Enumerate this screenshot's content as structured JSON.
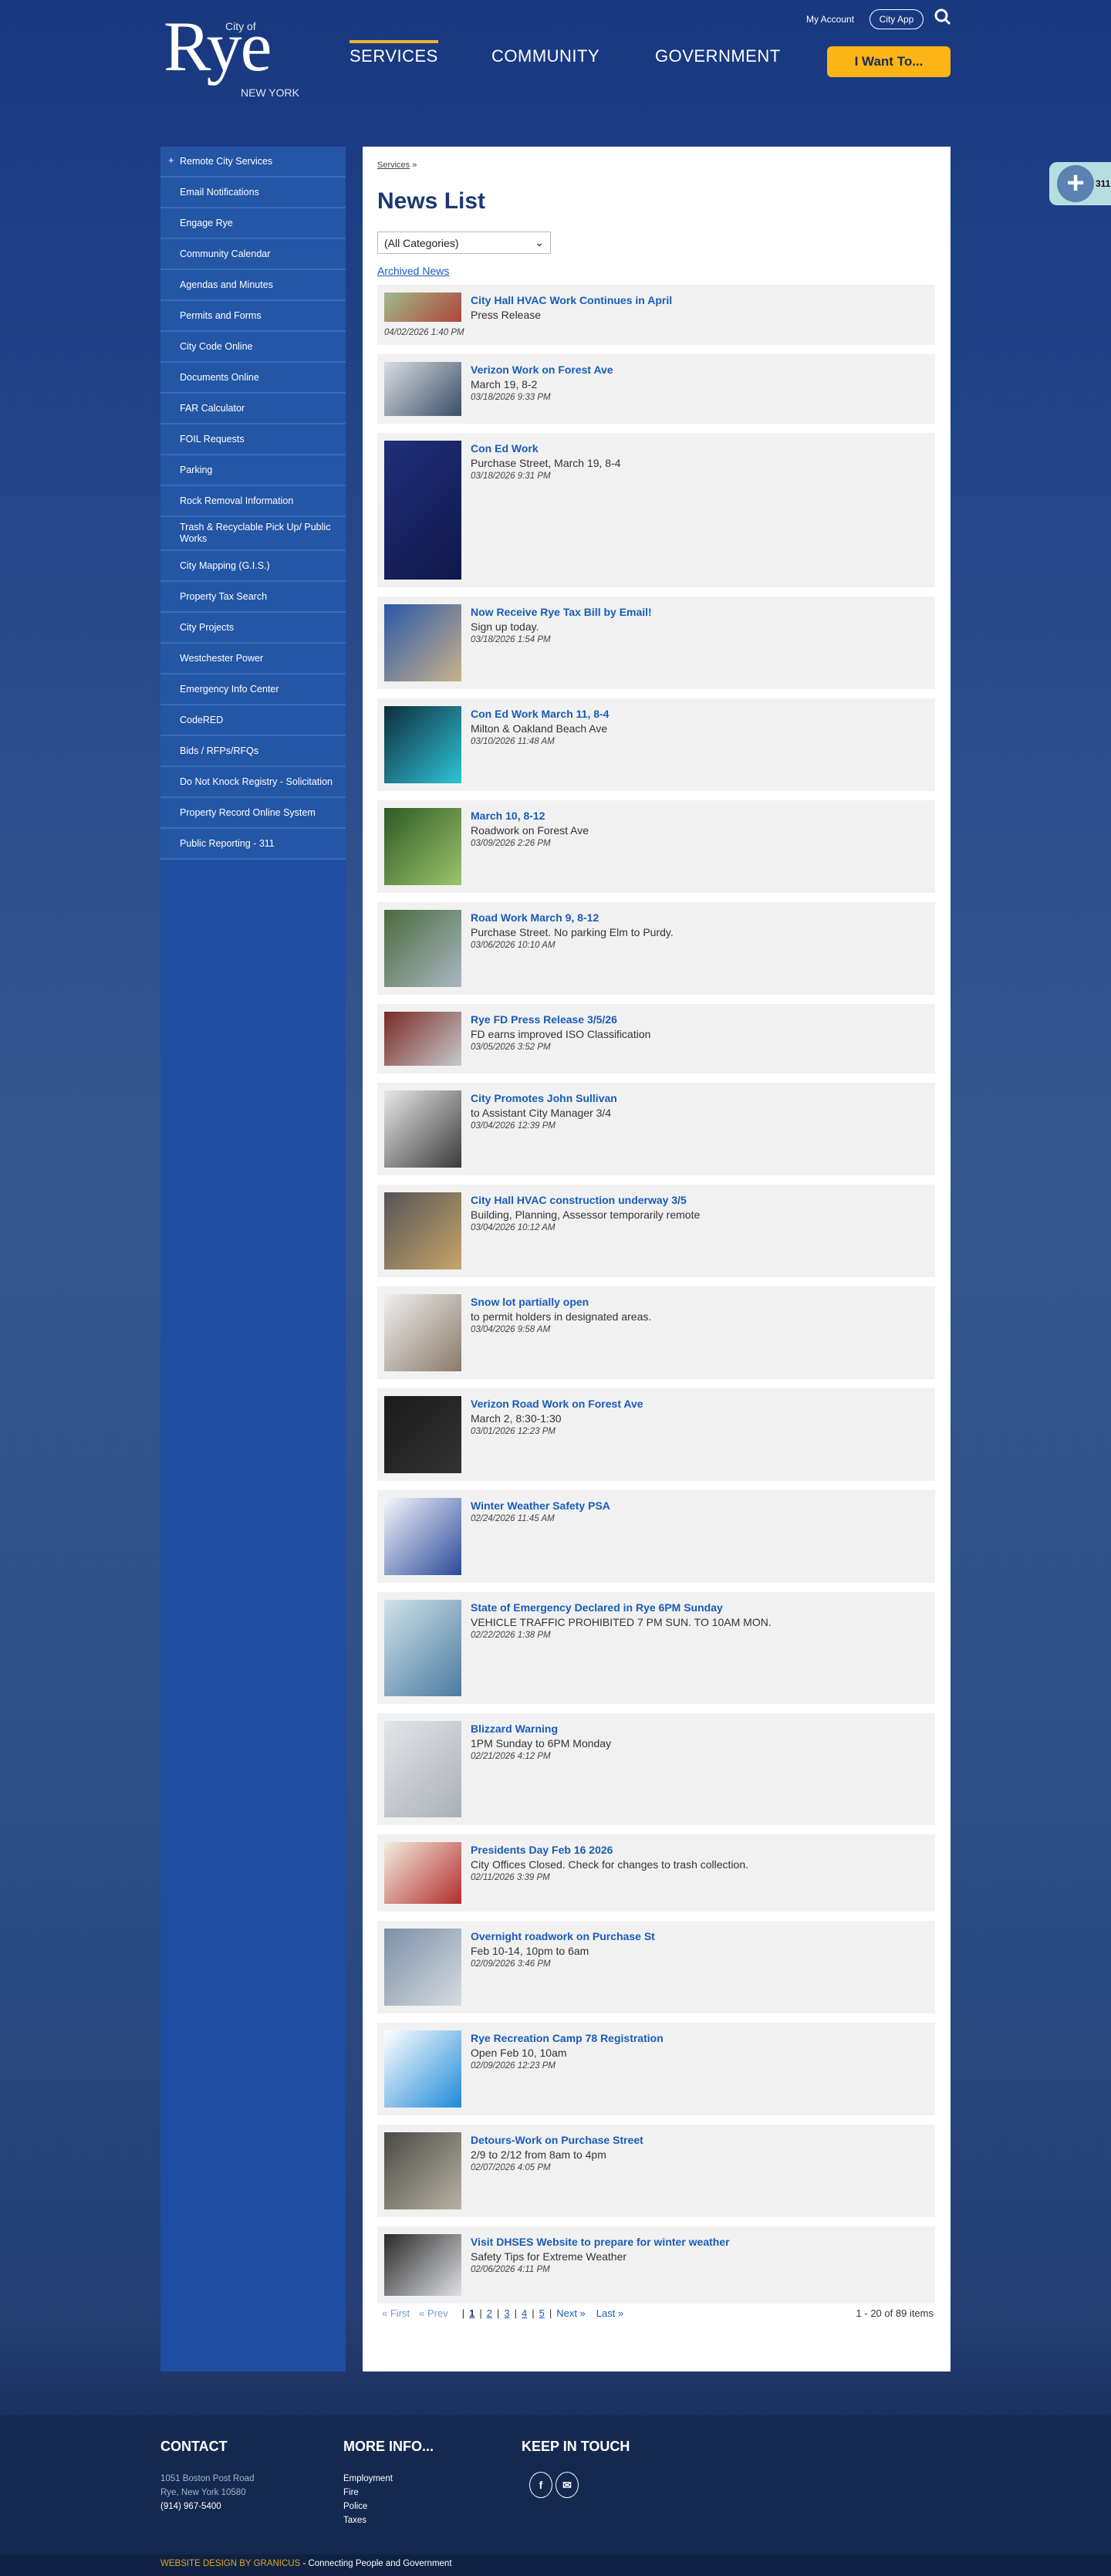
{
  "header": {
    "logo": {
      "city_of": "City of",
      "name": "Rye",
      "state": "NEW YORK"
    },
    "my_account": "My Account",
    "city_app": "City App",
    "nav": [
      "SERVICES",
      "COMMUNITY",
      "GOVERNMENT"
    ],
    "i_want_to": "I Want To..."
  },
  "sidebar": {
    "items": [
      "Remote City Services",
      "Email Notifications",
      "Engage Rye",
      "Community Calendar",
      "Agendas and Minutes",
      "Permits and Forms",
      "City Code Online",
      "Documents Online",
      "FAR Calculator",
      "FOIL Requests",
      "Parking",
      "Rock Removal Information",
      "Trash & Recyclable Pick Up/ Public Works",
      "City Mapping (G.I.S.)",
      "Property Tax Search",
      "City Projects",
      "Westchester Power",
      "Emergency Info Center",
      "CodeRED",
      "Bids / RFPs/RFQs",
      "Do Not Knock Registry - Solicitation",
      "Property Record Online System",
      "Public Reporting - 311"
    ]
  },
  "main": {
    "breadcrumb": "Services",
    "breadcrumb_sep": "»",
    "title": "News List",
    "category_select": "(All Categories)",
    "archived_link": "Archived News",
    "news": [
      {
        "title": "City Hall HVAC Work Continues in April",
        "sub": "Press Release",
        "date": "04/02/2026 1:40 PM"
      },
      {
        "title": "Verizon Work on Forest Ave",
        "sub": "March 19, 8-2",
        "date": "03/18/2026 9:33 PM"
      },
      {
        "title": "Con Ed Work",
        "sub": "Purchase Street, March 19, 8-4",
        "date": "03/18/2026 9:31 PM"
      },
      {
        "title": "Now Receive Rye Tax Bill by Email!",
        "sub": "Sign up today.",
        "date": "03/18/2026 1:54 PM"
      },
      {
        "title": "Con Ed Work March 11, 8-4",
        "sub": "Milton & Oakland Beach Ave",
        "date": "03/10/2026 11:48 AM"
      },
      {
        "title": "March 10, 8-12",
        "sub": "Roadwork on Forest Ave",
        "date": "03/09/2026 2:26 PM"
      },
      {
        "title": "Road Work March 9, 8-12",
        "sub": "Purchase Street. No parking Elm to Purdy.",
        "date": "03/06/2026 10:10 AM"
      },
      {
        "title": "Rye FD Press Release 3/5/26",
        "sub": "FD earns improved ISO Classification",
        "date": "03/05/2026 3:52 PM"
      },
      {
        "title": "City Promotes John Sullivan",
        "sub": "to Assistant City Manager 3/4",
        "date": "03/04/2026 12:39 PM"
      },
      {
        "title": "City Hall HVAC construction underway 3/5",
        "sub": "Building, Planning, Assessor temporarily remote",
        "date": "03/04/2026 10:12 AM"
      },
      {
        "title": "Snow lot partially open",
        "sub": "to permit holders in designated areas.",
        "date": "03/04/2026 9:58 AM"
      },
      {
        "title": "Verizon Road Work on Forest Ave",
        "sub": "March 2, 8:30-1:30",
        "date": "03/01/2026 12:23 PM"
      },
      {
        "title": "Winter Weather Safety PSA",
        "sub": "",
        "date": "02/24/2026 11:45 AM"
      },
      {
        "title": "State of Emergency Declared in Rye 6PM Sunday",
        "sub": "VEHICLE TRAFFIC PROHIBITED 7 PM SUN. TO 10AM MON.",
        "date": "02/22/2026 1:38 PM"
      },
      {
        "title": "Blizzard Warning",
        "sub": "1PM Sunday to 6PM Monday",
        "date": "02/21/2026 4:12 PM"
      },
      {
        "title": "Presidents Day Feb 16 2026",
        "sub": "City Offices Closed. Check for changes to trash collection.",
        "date": "02/11/2026 3:39 PM"
      },
      {
        "title": "Overnight roadwork on Purchase St",
        "sub": "Feb 10-14, 10pm to 6am",
        "date": "02/09/2026 3:46 PM"
      },
      {
        "title": "Rye Recreation Camp 78 Registration",
        "sub": "Open Feb 10, 10am",
        "date": "02/09/2026 12:23 PM"
      },
      {
        "title": "Detours-Work on Purchase Street",
        "sub": "2/9 to 2/12 from 8am to 4pm",
        "date": "02/07/2026 4:05 PM"
      },
      {
        "title": "Visit DHSES Website to prepare for winter weather",
        "sub": "Safety Tips for Extreme Weather",
        "date": "02/06/2026 4:11 PM"
      }
    ],
    "pager": {
      "first": "« First",
      "prev": "« Prev",
      "pages": [
        "1",
        "2",
        "3",
        "4",
        "5"
      ],
      "next": "Next »",
      "last": "Last »",
      "count": "1 - 20 of 89 items"
    }
  },
  "fab_label": "311",
  "footer": {
    "contact": {
      "heading": "CONTACT",
      "lines": [
        "1051 Boston Post Road",
        "Rye, New York 10580",
        "(914) 967-5400"
      ]
    },
    "more": {
      "heading": "MORE INFO...",
      "links": [
        "Employment",
        "Fire",
        "Police",
        "Taxes"
      ]
    },
    "touch": {
      "heading": "KEEP IN TOUCH"
    },
    "credit": "WEBSITE DESIGN BY GRANICUS",
    "tagline": " - Connecting People and Government"
  },
  "colors": {
    "brand_blue": "#1b3a7f",
    "accent_yellow": "#fdb515",
    "link": "#1a5cb8"
  }
}
